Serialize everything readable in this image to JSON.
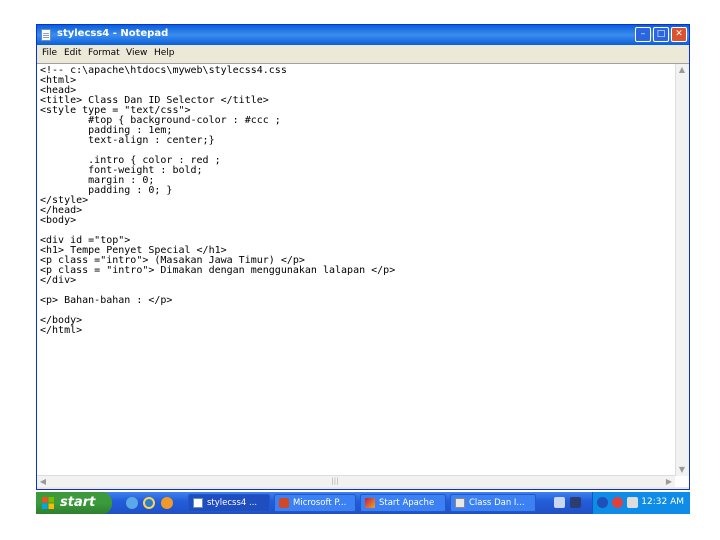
{
  "window": {
    "title": "stylecss4 - Notepad"
  },
  "menu": [
    "File",
    "Edit",
    "Format",
    "View",
    "Help"
  ],
  "editor": {
    "lines": [
      "<!-- c:\\apache\\htdocs\\myweb\\stylecss4.css",
      "<html>",
      "<head>",
      "<title> Class Dan ID Selector </title>",
      "<style type = \"text/css\">",
      "        #top { background-color : #ccc ;",
      "        padding : 1em;",
      "        text-align : center;}",
      "",
      "        .intro { color : red ;",
      "        font-weight : bold;",
      "        margin : 0;",
      "        padding : 0; }",
      "</style>",
      "</head>",
      "<body>",
      "",
      "<div id =\"top\">",
      "<h1> Tempe Penyet Special </h1>",
      "<p class =\"intro\"> (Masakan Jawa Timur) </p>",
      "<p class = \"intro\"> Dimakan dengan menggunakan lalapan </p>",
      "</div>",
      "",
      "<p> Bahan-bahan : </p>",
      "",
      "</body>",
      "</html>"
    ]
  },
  "taskbar": {
    "start_label": "start",
    "buttons": [
      {
        "label": "stylecss4 ...",
        "icon": "notepad-icon"
      },
      {
        "label": "Microsoft P...",
        "icon": "powerpoint-icon"
      },
      {
        "label": "Start Apache",
        "icon": "apache-icon"
      },
      {
        "label": "Class Dan I...",
        "icon": "browser-icon"
      }
    ],
    "clock": "12:32 AM"
  },
  "colors": {
    "titlebar": "#0a5fd8",
    "taskbar": "#245edb",
    "start_button": "#3c9a3c",
    "close_button": "#d8532e"
  }
}
